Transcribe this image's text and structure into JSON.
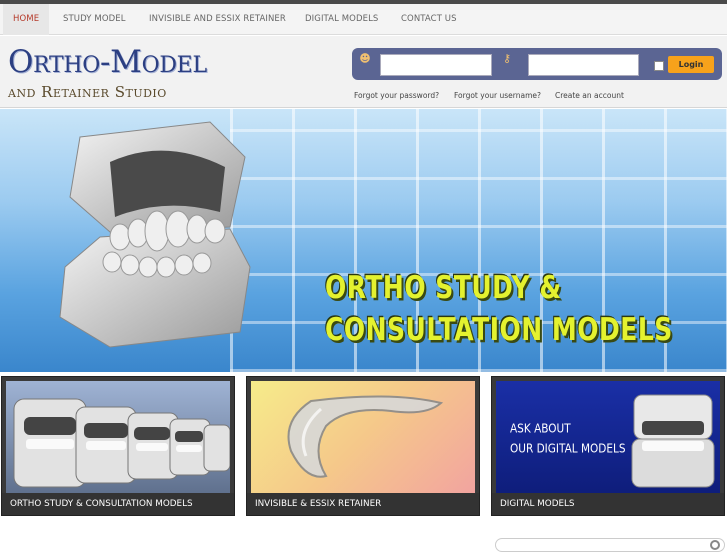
{
  "nav": {
    "items": [
      {
        "label": "HOME",
        "active": true
      },
      {
        "label": "STUDY MODEL"
      },
      {
        "label": "INVISIBLE AND ESSIX RETAINER"
      },
      {
        "label": "DIGITAL MODELS"
      },
      {
        "label": "CONTACT US"
      }
    ]
  },
  "logo": {
    "line1": "Ortho-Model",
    "line2": "and Retainer Studio"
  },
  "login": {
    "user_icon": "user-icon",
    "password_icon": "key-icon",
    "username_value": "",
    "password_value": "",
    "button_label": "Login",
    "links": {
      "forgot_password": "Forgot your password?",
      "forgot_username": "Forgot your username?",
      "create_account": "Create an account"
    }
  },
  "banner": {
    "caption_line1": "ORTHO STUDY &",
    "caption_line2": "CONSULTATION MODELS"
  },
  "tiles": [
    {
      "label": "ORTHO STUDY & CONSULTATION MODELS"
    },
    {
      "label": "INVISIBLE & ESSIX RETAINER"
    },
    {
      "label": "DIGITAL MODELS",
      "overlay_line1": "ASK ABOUT",
      "overlay_line2": "OUR DIGITAL MODELS"
    }
  ],
  "colors": {
    "nav_active": "#b53a2a",
    "logo_blue": "#2c3f82",
    "login_panel": "#5b6593",
    "login_button": "#f7a21b",
    "banner_caption": "#e4f22f"
  }
}
